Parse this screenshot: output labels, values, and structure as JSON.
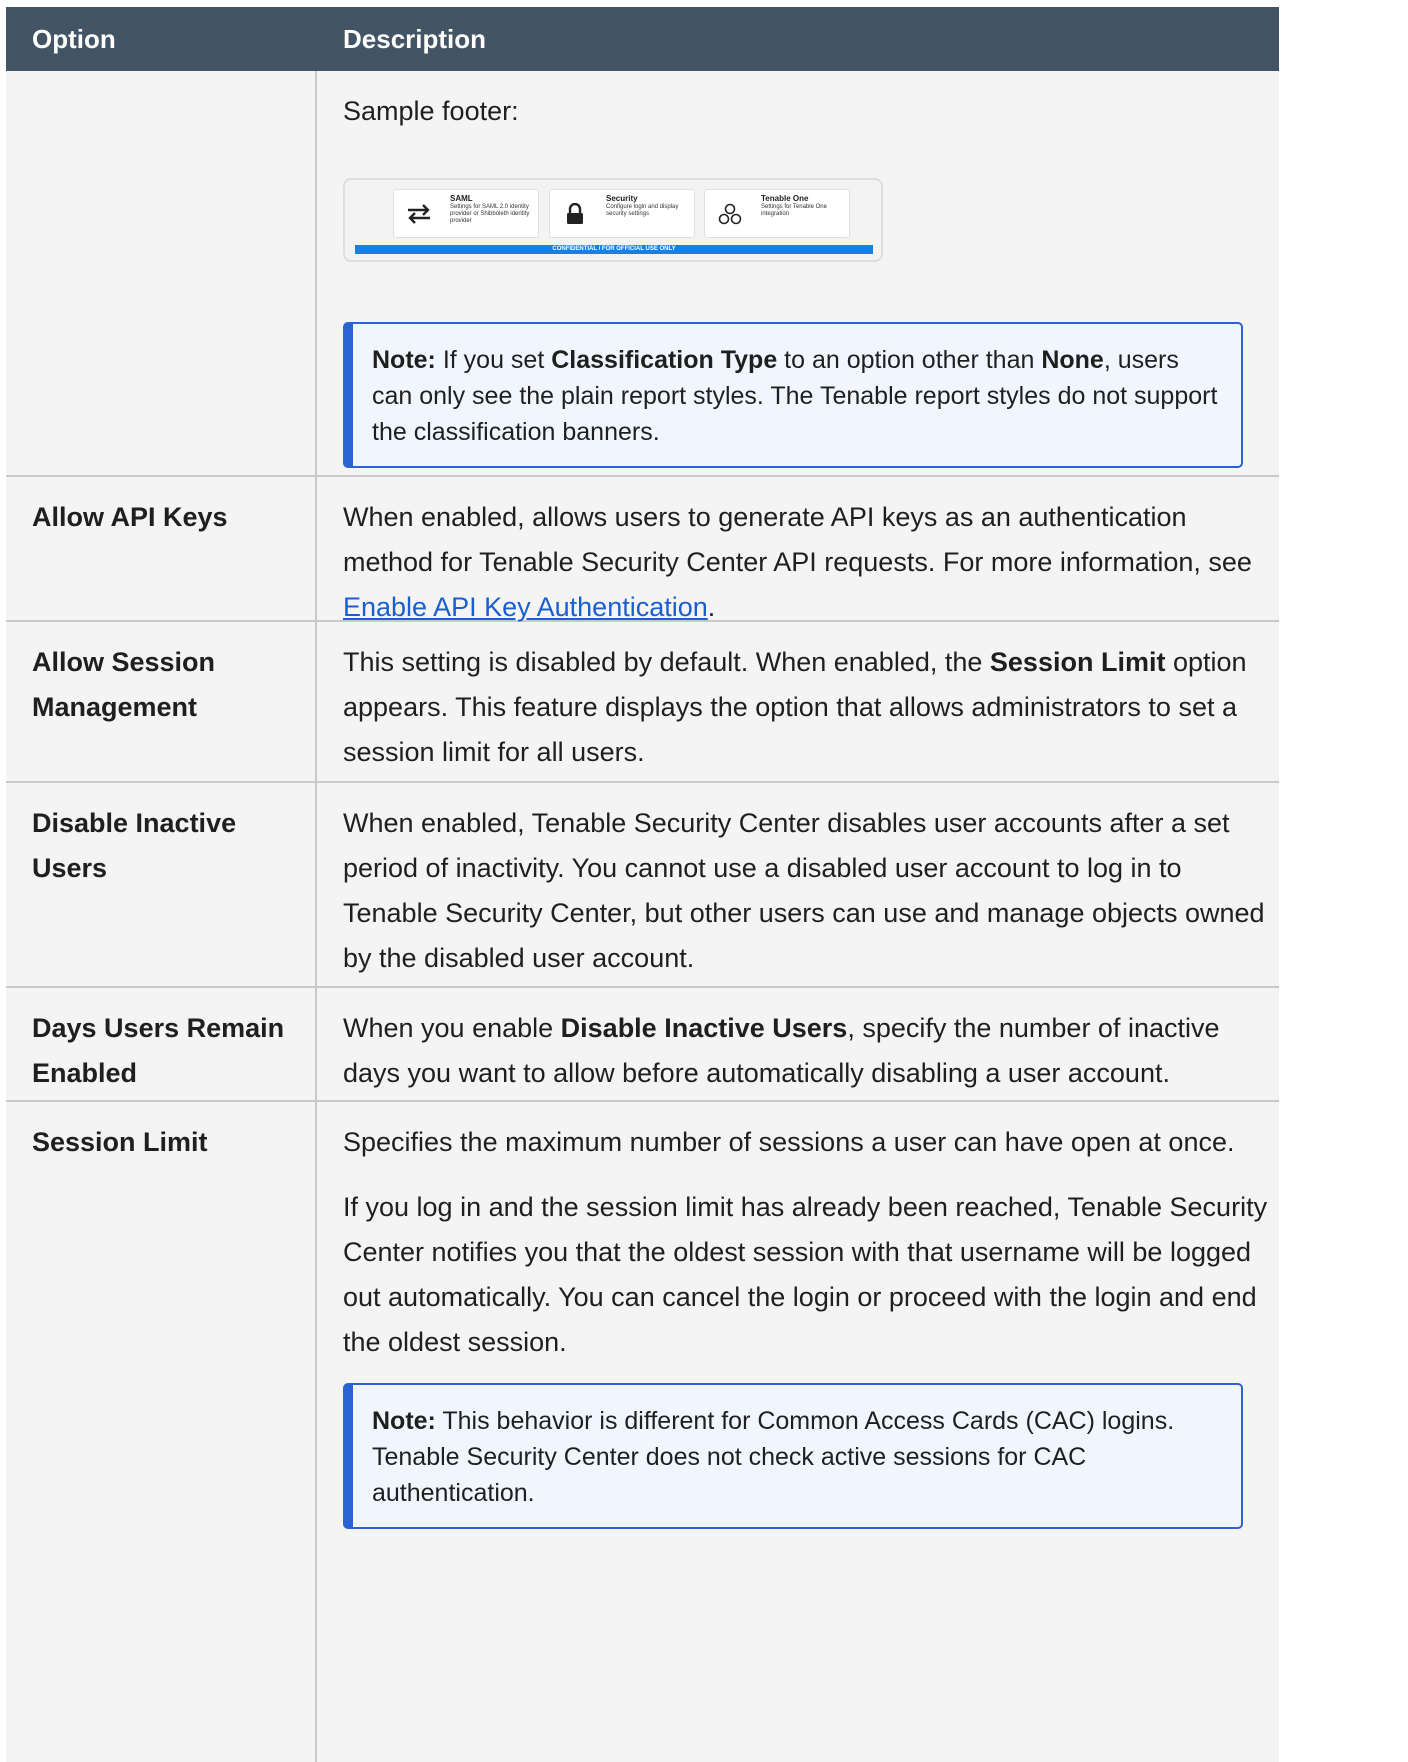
{
  "header": {
    "option": "Option",
    "description": "Description"
  },
  "row0": {
    "sample_label": "Sample footer:",
    "sample": {
      "cards": [
        {
          "title": "SAML",
          "desc": "Settings for SAML 2.0 identity provider or Shibboleth identity provider"
        },
        {
          "title": "Security",
          "desc": "Configure login and display security settings"
        },
        {
          "title": "Tenable One",
          "desc": "Settings for Tenable One integration"
        }
      ],
      "banner": "CONFIDENTIAL / FOR OFFICIAL USE ONLY",
      "banner_color": "#1c7fe0"
    },
    "note": {
      "label": "Note:",
      "t1": " If you set ",
      "b1": "Classification Type",
      "t2": " to an option other than ",
      "b2": "None",
      "t3": ", users can only see the plain report styles. The Tenable report styles do not support the classification banners."
    }
  },
  "rows": {
    "api": {
      "option": "Allow API Keys",
      "t1": "When enabled, allows users to generate API keys as an authentication method for Tenable Security Center API requests. For more information, see ",
      "link": "Enable API Key Authentication",
      "t2": "."
    },
    "session_mgmt": {
      "option": "Allow Session Management",
      "t1": "This setting is disabled by default. When enabled, the ",
      "b1": "Session Limit",
      "t2": " option appears. This feature displays the option that allows administrators to set a session limit for all users."
    },
    "disable_inactive": {
      "option": "Disable Inactive Users",
      "text": "When enabled, Tenable Security Center disables user accounts after a set period of inactivity. You cannot use a disabled user account to log in to Tenable Security Center, but other users can use and manage objects owned by the disabled user account."
    },
    "days_enabled": {
      "option": "Days Users Remain Enabled",
      "t1": "When you enable ",
      "b1": "Disable Inactive Users",
      "t2": ", specify the number of inactive days you want to allow before automatically disabling a user account."
    },
    "session_limit": {
      "option": "Session Limit",
      "p1": "Specifies the maximum number of sessions a user can have open at once.",
      "p2": "If you log in and the session limit has already been reached, Tenable Security Center notifies you that the oldest session with that username will be logged out automatically. You can cancel the login or proceed with the login and end the oldest session.",
      "note_label": "Note:",
      "note_text": " This behavior is different for Common Access Cards (CAC) logins. Tenable Security Center does not check active sessions for CAC authentication."
    }
  },
  "colors": {
    "header_bg": "#435465",
    "note_border": "#2b63d3",
    "link": "#1a5fd0",
    "row_bg": "#f4f4f4"
  }
}
